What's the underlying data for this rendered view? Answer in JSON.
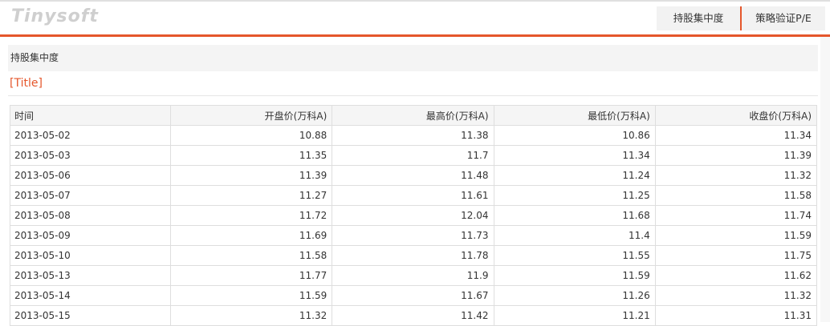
{
  "header": {
    "logo": "Tinysoft",
    "nav": [
      {
        "label": "持股集中度"
      },
      {
        "label": "策略验证P/E"
      }
    ]
  },
  "section": {
    "label": "持股集中度",
    "title": "[Title]"
  },
  "table": {
    "columns": [
      "时间",
      "开盘价(万科A)",
      "最高价(万科A)",
      "最低价(万科A)",
      "收盘价(万科A)"
    ],
    "rows": [
      [
        "2013-05-02",
        "10.88",
        "11.38",
        "10.86",
        "11.34"
      ],
      [
        "2013-05-03",
        "11.35",
        "11.7",
        "11.34",
        "11.39"
      ],
      [
        "2013-05-06",
        "11.39",
        "11.48",
        "11.24",
        "11.32"
      ],
      [
        "2013-05-07",
        "11.27",
        "11.61",
        "11.25",
        "11.58"
      ],
      [
        "2013-05-08",
        "11.72",
        "12.04",
        "11.68",
        "11.74"
      ],
      [
        "2013-05-09",
        "11.69",
        "11.73",
        "11.4",
        "11.59"
      ],
      [
        "2013-05-10",
        "11.58",
        "11.78",
        "11.55",
        "11.75"
      ],
      [
        "2013-05-13",
        "11.77",
        "11.9",
        "11.59",
        "11.62"
      ],
      [
        "2013-05-14",
        "11.59",
        "11.67",
        "11.26",
        "11.32"
      ],
      [
        "2013-05-15",
        "11.32",
        "11.42",
        "11.21",
        "11.31"
      ]
    ]
  },
  "colors": {
    "accent": "#e5562b",
    "logo": "#cfcfcf",
    "header_bg": "#f4f4f4"
  }
}
